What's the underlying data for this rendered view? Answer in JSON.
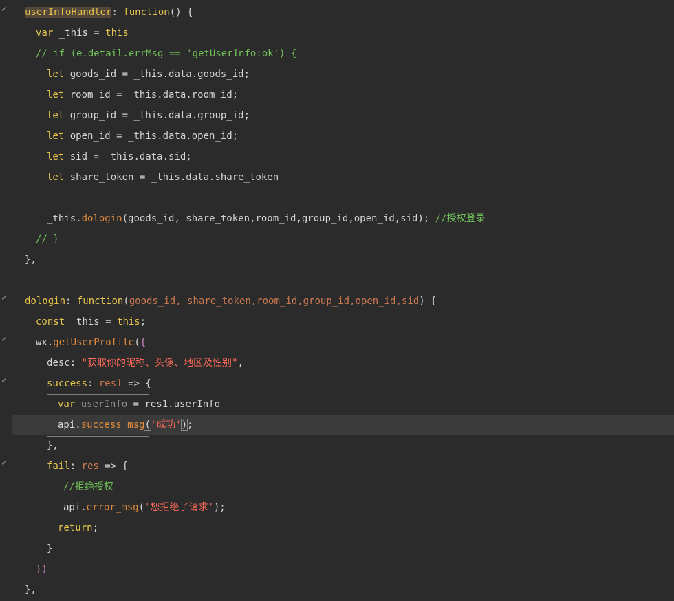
{
  "editor": {
    "lines": [
      {
        "tokens": [
          [
            "userInfoHandler",
            "fnname fn-hi"
          ],
          [
            ": ",
            "punct"
          ],
          [
            "function",
            "kw"
          ],
          [
            "() {",
            "punct"
          ]
        ]
      },
      {
        "tokens": [
          [
            "var",
            "kw"
          ],
          [
            " _this = ",
            "plain"
          ],
          [
            "this",
            "kw"
          ]
        ]
      },
      {
        "tokens": [
          [
            "// if (e.detail.errMsg == 'getUserInfo:ok') {",
            "comment"
          ]
        ]
      },
      {
        "tokens": [
          [
            "let",
            "kw"
          ],
          [
            " goods_id = _this.data.goods_id;",
            "plain"
          ]
        ]
      },
      {
        "tokens": [
          [
            "let",
            "kw"
          ],
          [
            " room_id = _this.data.room_id;",
            "plain"
          ]
        ]
      },
      {
        "tokens": [
          [
            "let",
            "kw"
          ],
          [
            " group_id = _this.data.group_id;",
            "plain"
          ]
        ]
      },
      {
        "tokens": [
          [
            "let",
            "kw"
          ],
          [
            " open_id = _this.data.open_id;",
            "plain"
          ]
        ]
      },
      {
        "tokens": [
          [
            "let",
            "kw"
          ],
          [
            " sid = _this.data.sid;",
            "plain"
          ]
        ]
      },
      {
        "tokens": [
          [
            "let",
            "kw"
          ],
          [
            " share_token = _this.data.share_token",
            "plain"
          ]
        ]
      },
      {
        "tokens": []
      },
      {
        "tokens": [
          [
            "_this.",
            "plain"
          ],
          [
            "dologin",
            "method"
          ],
          [
            "(goods_id, share_token,room_id,group_id,open_id,sid); ",
            "plain"
          ],
          [
            "//授权登录",
            "comment"
          ]
        ]
      },
      {
        "tokens": [
          [
            "// }",
            "comment"
          ]
        ]
      },
      {
        "tokens": [
          [
            "},",
            "punct"
          ]
        ]
      },
      {
        "tokens": []
      },
      {
        "tokens": [
          [
            "dologin",
            "fnname"
          ],
          [
            ": ",
            "punct"
          ],
          [
            "function",
            "kw"
          ],
          [
            "(",
            "punct"
          ],
          [
            "goods_id, share_token,room_id,group_id,open_id,sid",
            "param"
          ],
          [
            ") {",
            "punct"
          ]
        ]
      },
      {
        "tokens": [
          [
            "const",
            "kw"
          ],
          [
            " _this = ",
            "plain"
          ],
          [
            "this",
            "kw"
          ],
          [
            ";",
            "punct"
          ]
        ]
      },
      {
        "tokens": [
          [
            "wx.",
            "plain"
          ],
          [
            "getUserProfile",
            "method"
          ],
          [
            "(",
            "plain"
          ],
          [
            "{",
            "brace-purple"
          ]
        ]
      },
      {
        "tokens": [
          [
            "desc: ",
            "plain"
          ],
          [
            "\"获取你的昵称、头像、地区及性别\"",
            "strzh"
          ],
          [
            ",",
            "punct"
          ]
        ]
      },
      {
        "tokens": [
          [
            "success",
            "prop"
          ],
          [
            ": ",
            "punct"
          ],
          [
            "res1",
            "param"
          ],
          [
            " => {",
            "plain"
          ]
        ]
      },
      {
        "tokens": [
          [
            "var",
            "kw"
          ],
          [
            " ",
            "plain"
          ],
          [
            "userInfo",
            "dim"
          ],
          [
            " = res1.userInfo",
            "plain"
          ]
        ]
      },
      {
        "tokens": [
          [
            "api.",
            "plain"
          ],
          [
            "success_msg",
            "method"
          ],
          [
            "(",
            "plain paren-hi"
          ],
          [
            "'成功'",
            "strzh"
          ],
          [
            ")",
            "plain paren-hi"
          ],
          [
            ";",
            "punct"
          ]
        ]
      },
      {
        "tokens": [
          [
            "},",
            "punct"
          ]
        ]
      },
      {
        "tokens": [
          [
            "fail",
            "prop"
          ],
          [
            ": ",
            "punct"
          ],
          [
            "res",
            "param"
          ],
          [
            " => {",
            "plain"
          ]
        ]
      },
      {
        "tokens": [
          [
            "//拒绝授权",
            "comment"
          ]
        ]
      },
      {
        "tokens": [
          [
            "api.",
            "plain"
          ],
          [
            "error_msg",
            "method"
          ],
          [
            "(",
            "plain"
          ],
          [
            "'您拒绝了请求'",
            "strzh"
          ],
          [
            ");",
            "punct"
          ]
        ]
      },
      {
        "tokens": [
          [
            "return",
            "kw"
          ],
          [
            ";",
            "punct"
          ]
        ]
      },
      {
        "tokens": [
          [
            "}",
            "punct"
          ]
        ]
      },
      {
        "tokens": [
          [
            "})",
            "brace-purple"
          ]
        ]
      },
      {
        "tokens": [
          [
            "},",
            "punct"
          ]
        ]
      }
    ]
  }
}
